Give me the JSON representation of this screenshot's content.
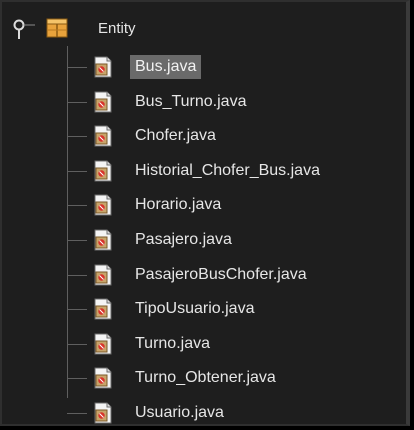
{
  "tree": {
    "root": {
      "label": "Entity",
      "toggle_icon": "expanded-node-icon",
      "icon": "package-icon",
      "expanded": true
    },
    "files": [
      {
        "label": "Bus.java",
        "icon": "java-file-icon",
        "selected": true
      },
      {
        "label": "Bus_Turno.java",
        "icon": "java-file-icon",
        "selected": false
      },
      {
        "label": "Chofer.java",
        "icon": "java-file-icon",
        "selected": false
      },
      {
        "label": "Historial_Chofer_Bus.java",
        "icon": "java-file-icon",
        "selected": false
      },
      {
        "label": "Horario.java",
        "icon": "java-file-icon",
        "selected": false
      },
      {
        "label": "Pasajero.java",
        "icon": "java-file-icon",
        "selected": false
      },
      {
        "label": "PasajeroBusChofer.java",
        "icon": "java-file-icon",
        "selected": false
      },
      {
        "label": "TipoUsuario.java",
        "icon": "java-file-icon",
        "selected": false
      },
      {
        "label": "Turno.java",
        "icon": "java-file-icon",
        "selected": false
      },
      {
        "label": "Turno_Obtener.java",
        "icon": "java-file-icon",
        "selected": false
      },
      {
        "label": "Usuario.java",
        "icon": "java-file-icon",
        "selected": false
      }
    ]
  },
  "colors": {
    "background": "#1e1e1e",
    "text": "#e6e6e6",
    "selection": "#6a6a6a",
    "folder": "#e8a33c",
    "tree_lines": "#5f5f5f"
  }
}
